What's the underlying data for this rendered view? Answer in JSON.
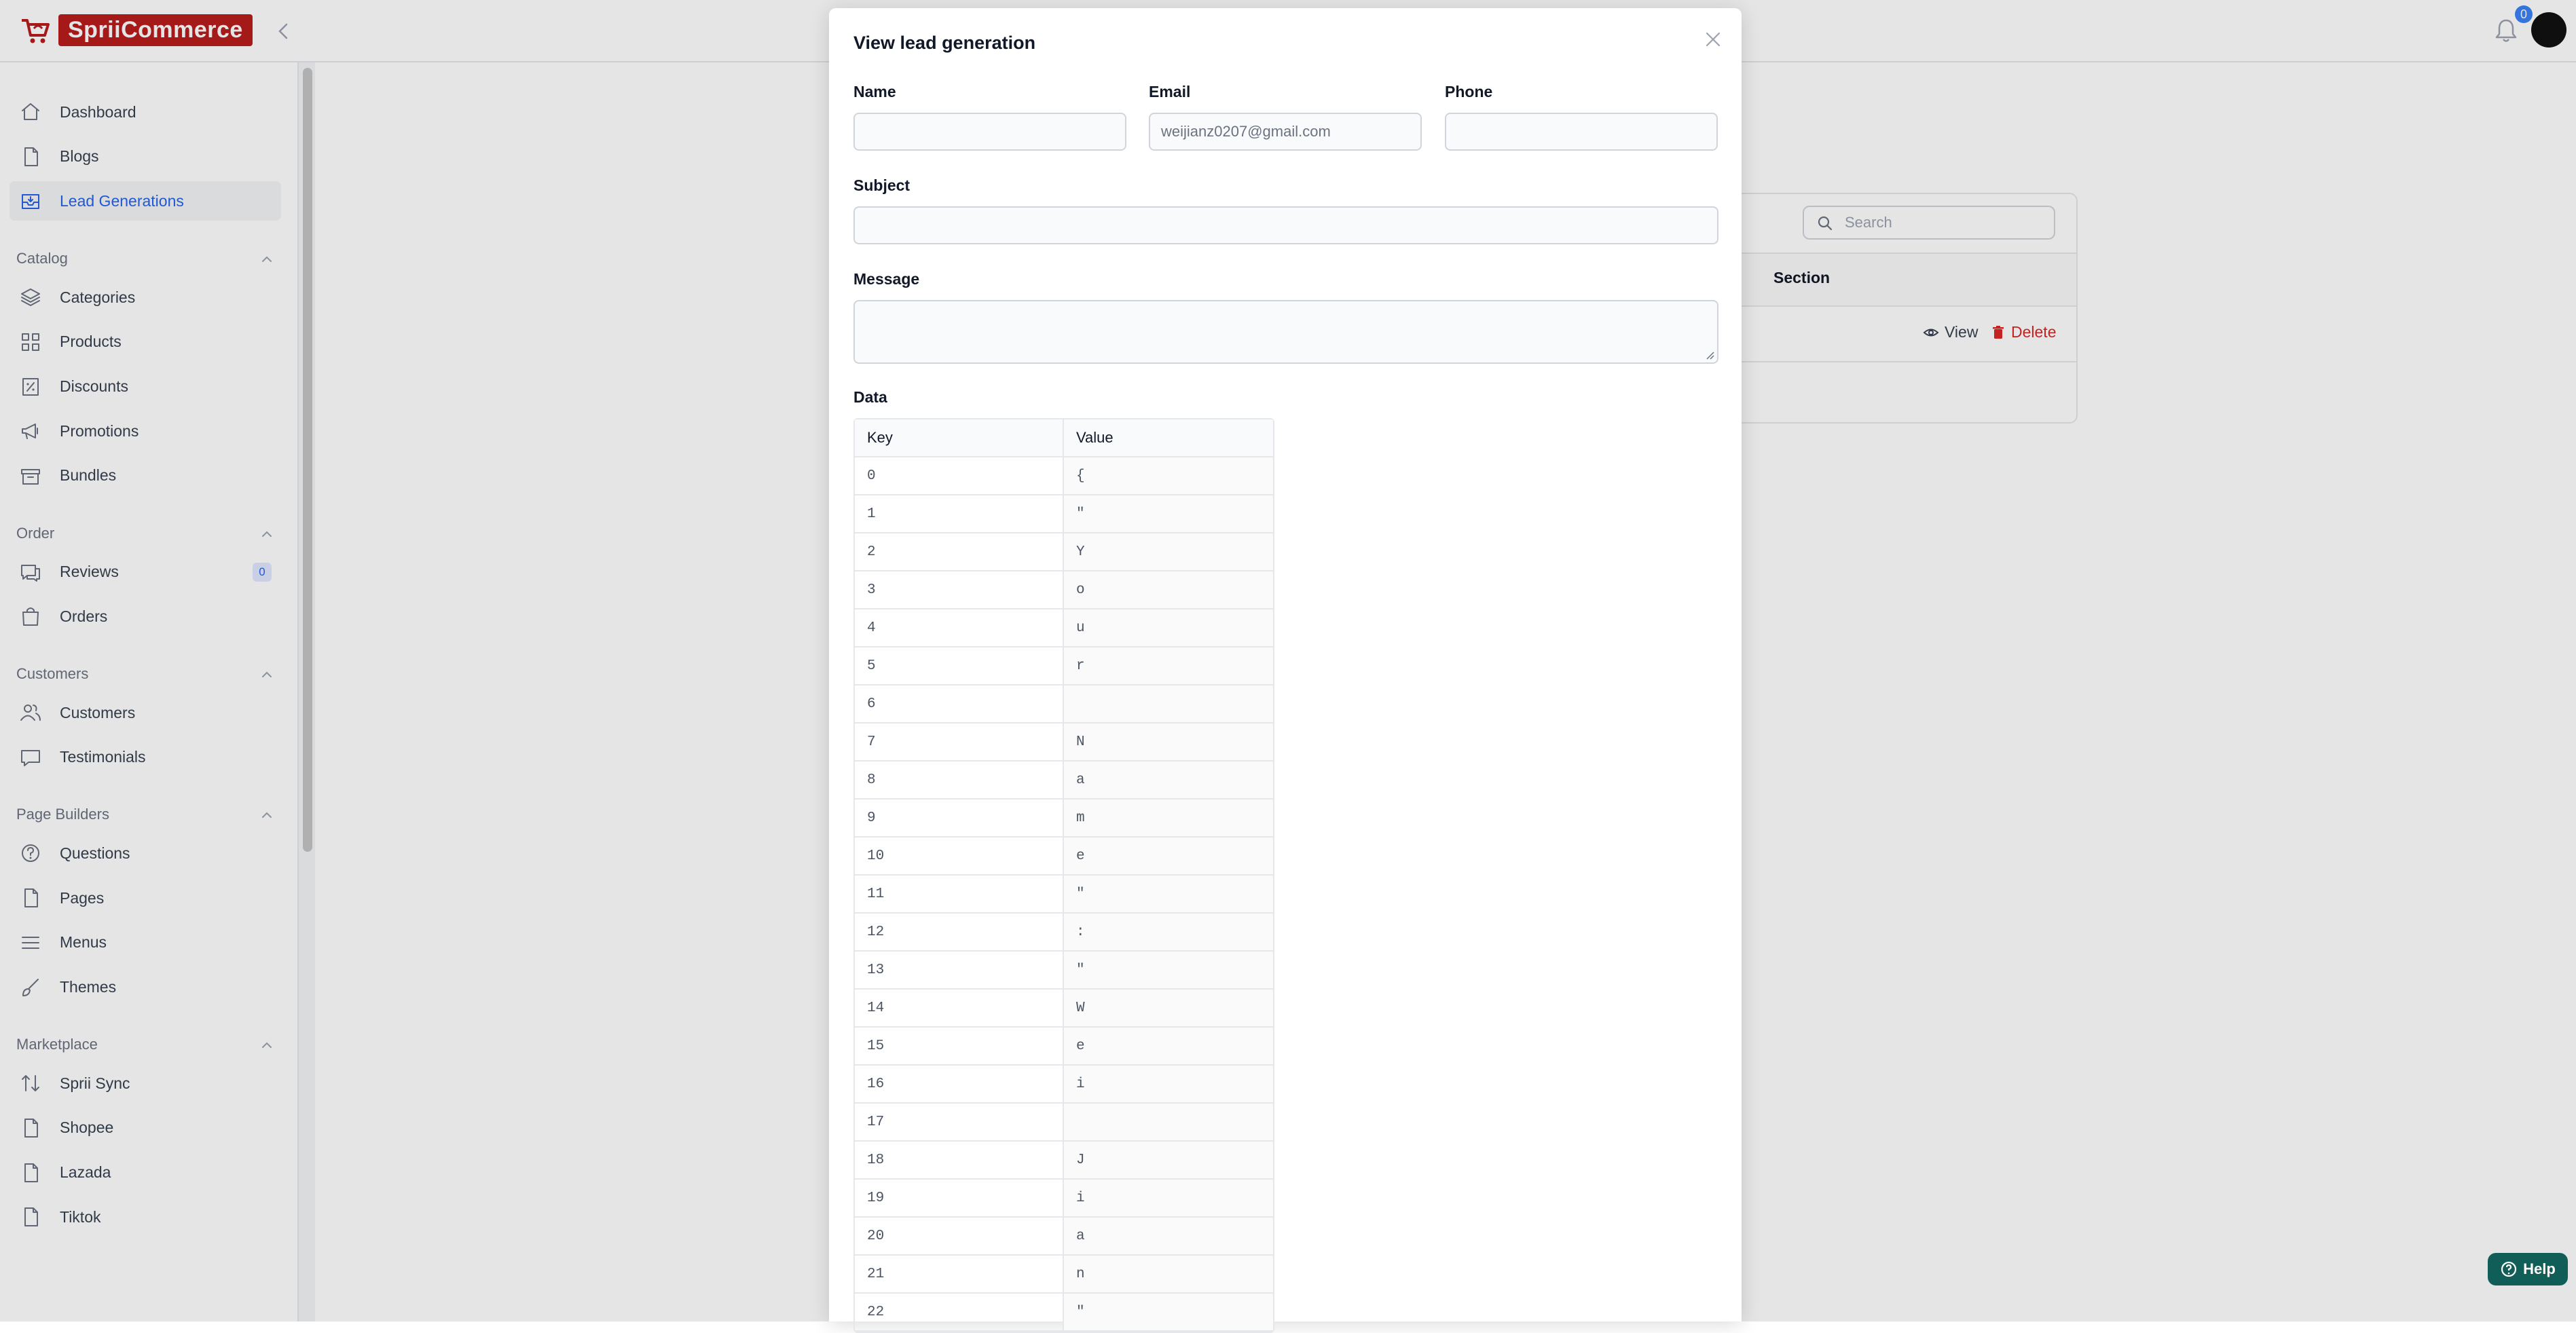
{
  "brand": {
    "name": "SpriiCommerce"
  },
  "topbar": {
    "notification_count": "0"
  },
  "sidebar": {
    "top_items": [
      {
        "label": "Dashboard",
        "icon": "home-icon"
      },
      {
        "label": "Blogs",
        "icon": "document-icon"
      },
      {
        "label": "Lead Generations",
        "icon": "inbox-icon",
        "active": true
      }
    ],
    "sections": [
      {
        "title": "Catalog",
        "items": [
          {
            "label": "Categories",
            "icon": "layers-icon"
          },
          {
            "label": "Products",
            "icon": "grid-icon"
          },
          {
            "label": "Discounts",
            "icon": "percent-icon"
          },
          {
            "label": "Promotions",
            "icon": "megaphone-icon"
          },
          {
            "label": "Bundles",
            "icon": "archive-icon"
          }
        ]
      },
      {
        "title": "Order",
        "items": [
          {
            "label": "Reviews",
            "icon": "chat-icon",
            "count": "0"
          },
          {
            "label": "Orders",
            "icon": "bag-icon"
          }
        ]
      },
      {
        "title": "Customers",
        "items": [
          {
            "label": "Customers",
            "icon": "users-icon"
          },
          {
            "label": "Testimonials",
            "icon": "comment-icon"
          }
        ]
      },
      {
        "title": "Page Builders",
        "items": [
          {
            "label": "Questions",
            "icon": "question-icon"
          },
          {
            "label": "Pages",
            "icon": "document-icon"
          },
          {
            "label": "Menus",
            "icon": "menu-icon"
          },
          {
            "label": "Themes",
            "icon": "brush-icon"
          }
        ]
      },
      {
        "title": "Marketplace",
        "items": [
          {
            "label": "Sprii Sync",
            "icon": "sync-icon"
          },
          {
            "label": "Shopee",
            "icon": "document-icon"
          },
          {
            "label": "Lazada",
            "icon": "document-icon"
          },
          {
            "label": "Tiktok",
            "icon": "document-icon"
          }
        ]
      }
    ]
  },
  "background": {
    "search_placeholder": "Search",
    "section_header": "Section",
    "view_label": "View",
    "delete_label": "Delete"
  },
  "help": {
    "label": "Help"
  },
  "modal": {
    "title": "View lead generation",
    "fields": {
      "name_label": "Name",
      "name_value": "",
      "email_label": "Email",
      "email_value": "weijianz0207@gmail.com",
      "phone_label": "Phone",
      "phone_value": "",
      "subject_label": "Subject",
      "subject_value": "",
      "message_label": "Message",
      "message_value": ""
    },
    "data_label": "Data",
    "table": {
      "key_header": "Key",
      "value_header": "Value",
      "rows": [
        [
          "0",
          "{"
        ],
        [
          "1",
          "\""
        ],
        [
          "2",
          "Y"
        ],
        [
          "3",
          "o"
        ],
        [
          "4",
          "u"
        ],
        [
          "5",
          "r"
        ],
        [
          "6",
          ""
        ],
        [
          "7",
          "N"
        ],
        [
          "8",
          "a"
        ],
        [
          "9",
          "m"
        ],
        [
          "10",
          "e"
        ],
        [
          "11",
          "\""
        ],
        [
          "12",
          ":"
        ],
        [
          "13",
          "\""
        ],
        [
          "14",
          "W"
        ],
        [
          "15",
          "e"
        ],
        [
          "16",
          "i"
        ],
        [
          "17",
          ""
        ],
        [
          "18",
          "J"
        ],
        [
          "19",
          "i"
        ],
        [
          "20",
          "a"
        ],
        [
          "21",
          "n"
        ],
        [
          "22",
          "\""
        ]
      ]
    }
  },
  "colors": {
    "accent": "#2563eb",
    "brand": "#b91c1c",
    "danger": "#dc2626",
    "help": "#115e59"
  }
}
